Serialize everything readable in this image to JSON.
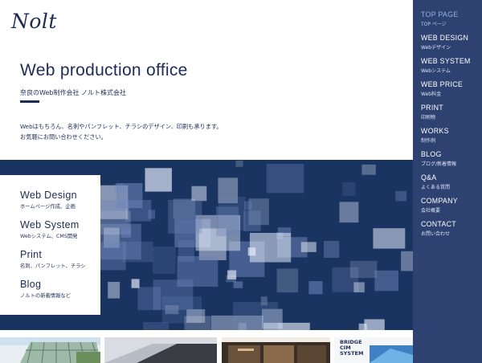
{
  "brand": {
    "logo": "Nolt"
  },
  "hero": {
    "title": "Web production office",
    "subtitle": "奈良のWeb制作会社 ノルト株式会社",
    "description": [
      "Webはもちろん、名刺やパンフレット、チラシのデザイン、印刷も承ります。",
      "お気軽にお問い合わせください。"
    ]
  },
  "services": [
    {
      "title": "Web Design",
      "sub": "ホームページ作成、企画"
    },
    {
      "title": "Web System",
      "sub": "Webシステム、CMS開発"
    },
    {
      "title": "Print",
      "sub": "名刺、パンフレット、チラシ"
    },
    {
      "title": "Blog",
      "sub": "ノルトの新着情報など"
    }
  ],
  "nav": [
    {
      "en": "TOP PAGE",
      "jp": "TOP ページ",
      "active": true
    },
    {
      "en": "WEB DESIGN",
      "jp": "Webデザイン"
    },
    {
      "en": "WEB SYSTEM",
      "jp": "Webシステム"
    },
    {
      "en": "WEB PRICE",
      "jp": "Web料金"
    },
    {
      "en": "PRINT",
      "jp": "印刷物"
    },
    {
      "en": "WORKS",
      "jp": "制作例"
    },
    {
      "en": "BLOG",
      "jp": "ブログ/新着情報"
    },
    {
      "en": "Q&A",
      "jp": "よくある質問"
    },
    {
      "en": "COMPANY",
      "jp": "会社概要"
    },
    {
      "en": "CONTACT",
      "jp": "お問い合わせ"
    }
  ],
  "thumbnails": [
    {
      "name": "greenhouse"
    },
    {
      "name": "roof"
    },
    {
      "name": "dark-site"
    },
    {
      "name": "bridge-cim-system",
      "label": "BRIDGE\nCIM\nSYSTEM"
    }
  ],
  "colors": {
    "navy": "#1e2b55",
    "sidebar": "#2e4272",
    "banner": "#1a3462",
    "nav_active": "#8fb2e6"
  }
}
